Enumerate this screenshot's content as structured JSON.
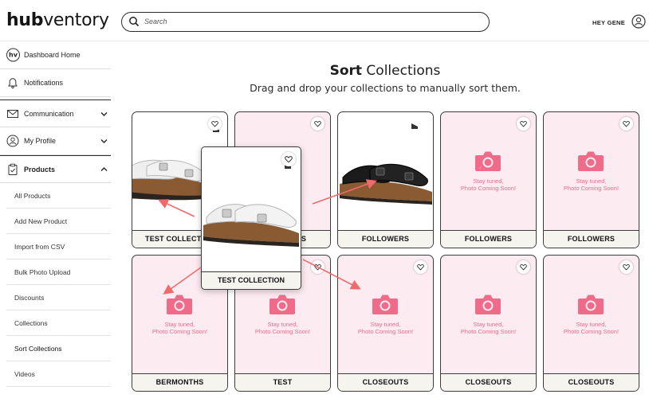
{
  "header": {
    "logo_bold": "hub",
    "logo_light": "ventory",
    "search_placeholder": "Search",
    "greeting": "HEY GENE"
  },
  "sidebar": {
    "items": [
      {
        "label": "Dashboard Home",
        "icon": "hv-logo-icon"
      },
      {
        "label": "Notifications",
        "icon": "bell-icon"
      },
      {
        "label": "Communication",
        "icon": "envelope-icon"
      },
      {
        "label": "My Profile",
        "icon": "user-icon"
      },
      {
        "label": "Products",
        "icon": "clipboard-icon"
      }
    ],
    "badge": "hv",
    "sub_items": [
      {
        "label": "All Products"
      },
      {
        "label": "Add New Product"
      },
      {
        "label": "Import from CSV"
      },
      {
        "label": "Bulk Photo Upload"
      },
      {
        "label": "Discounts"
      },
      {
        "label": "Collections"
      },
      {
        "label": "Sort Collections"
      },
      {
        "label": "Videos"
      }
    ],
    "active_sub_item": "Sort Collections"
  },
  "main": {
    "title_bold": "Sort",
    "title_rest": " Collections",
    "subtitle": "Drag and drop your collections to manually sort them.",
    "placeholder_line1": "Stay tuned,",
    "placeholder_line2": "Photo Coming Soon!",
    "cards": [
      {
        "label": "TEST COLLECTION",
        "image": "white-sandal"
      },
      {
        "label": "FOLLOWERS",
        "image": "placeholder"
      },
      {
        "label": "FOLLOWERS",
        "image": "black-sandal"
      },
      {
        "label": "FOLLOWERS",
        "image": "placeholder"
      },
      {
        "label": "FOLLOWERS",
        "image": "placeholder"
      },
      {
        "label": "BERMONTHS",
        "image": "placeholder"
      },
      {
        "label": "TEST",
        "image": "placeholder"
      },
      {
        "label": "CLOSEOUTS",
        "image": "placeholder"
      },
      {
        "label": "CLOSEOUTS",
        "image": "placeholder"
      },
      {
        "label": "CLOSEOUTS",
        "image": "placeholder"
      }
    ],
    "dragging_card": {
      "label": "TEST COLLECTION",
      "image": "white-sandal"
    }
  },
  "colors": {
    "placeholder_bg": "#fcebf1",
    "accent_pink": "#f06a8a",
    "arrow": "#ef6b6b",
    "label_bg": "#f6f4ee"
  }
}
